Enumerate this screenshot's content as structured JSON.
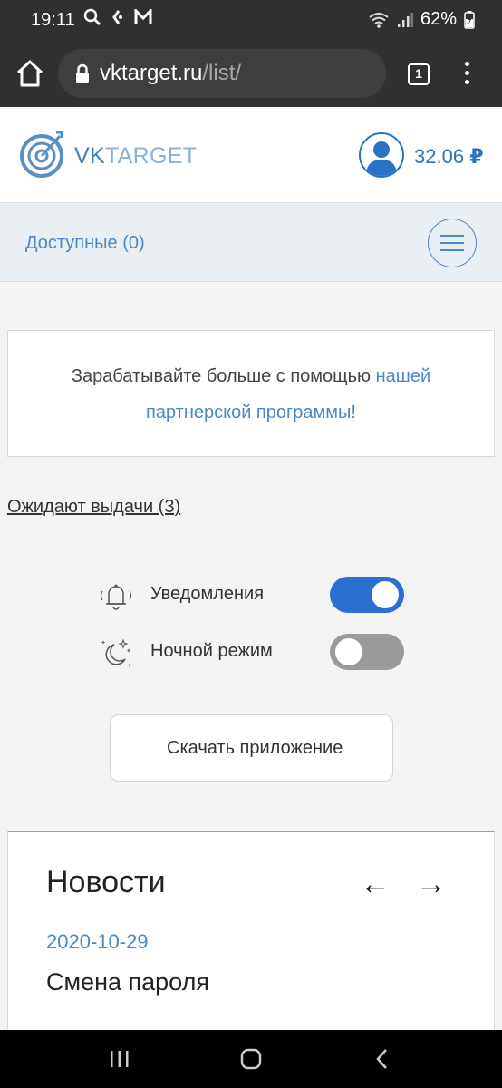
{
  "status_bar": {
    "time": "19:11",
    "battery": "62%",
    "left_icons": [
      "search-icon",
      "ruble-icon",
      "gmail-icon"
    ],
    "right_icons": [
      "wifi-icon",
      "signal-icon",
      "battery-icon"
    ]
  },
  "browser": {
    "url_host": "vktarget.ru",
    "url_path": "/list/",
    "tab_count": "1"
  },
  "header": {
    "logo_part1": "VK",
    "logo_part2": "TARGET",
    "balance_amount": "32.06",
    "currency": "₽"
  },
  "nav": {
    "available_label": "Доступные (0)"
  },
  "partner": {
    "text": "Зарабатывайте больше с помощью ",
    "link_part1": "нашей",
    "link_part2": "партнерской программы!"
  },
  "pending": {
    "label": "Ожидают выдачи (3)"
  },
  "toggles": {
    "notifications_label": "Уведомления",
    "notifications_on": true,
    "night_mode_label": "Ночной режим",
    "night_mode_on": false
  },
  "download": {
    "label": "Скачать приложение"
  },
  "news": {
    "title": "Новости",
    "prev": "←",
    "next": "→",
    "date": "2020-10-29",
    "heading": "Смена пароля"
  },
  "colors": {
    "accent": "#2a72c4",
    "link": "#4a88c7",
    "toggle_on": "#2b6fd1",
    "toggle_off": "#9a9a9a"
  }
}
